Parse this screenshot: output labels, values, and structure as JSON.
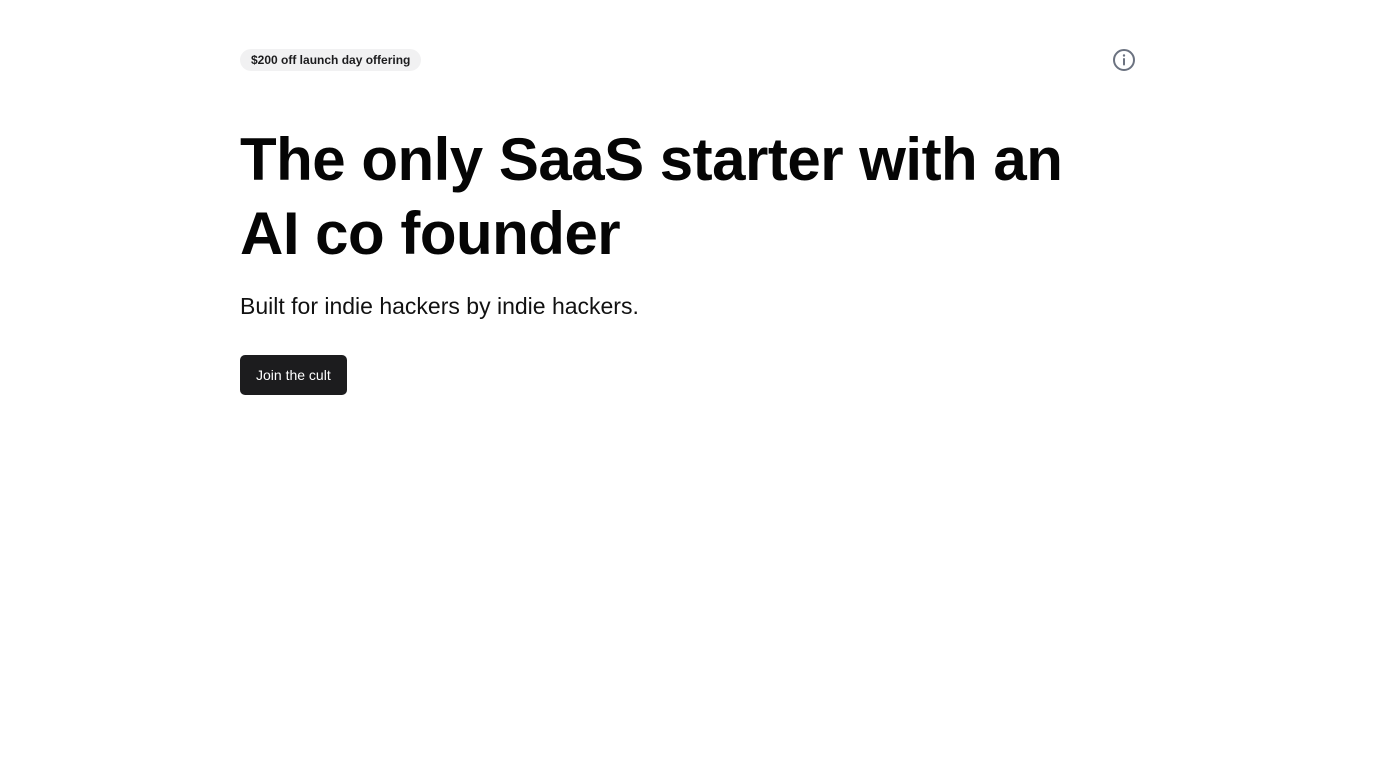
{
  "header": {
    "badge_text": "$200 off launch day offering",
    "info_icon": "info-circle-icon"
  },
  "hero": {
    "headline_line1": "The only SaaS starter with an",
    "headline_line2": "AI co founder",
    "subheadline": "Built for indie hackers by indie hackers.",
    "cta_label": "Join the cult"
  },
  "colors": {
    "badge_bg": "#f1f1f2",
    "button_bg": "#1c1c1e",
    "icon": "#6b7280"
  }
}
